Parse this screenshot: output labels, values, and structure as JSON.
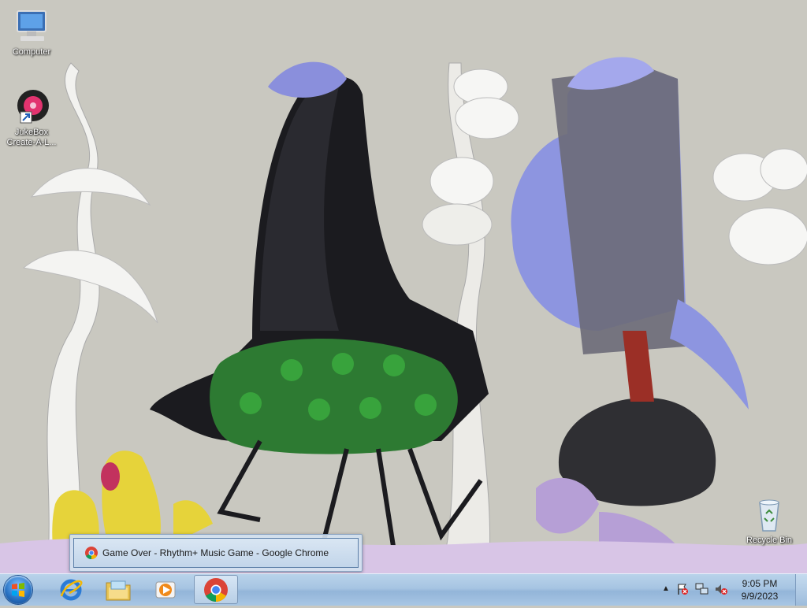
{
  "desktop": {
    "icons": [
      {
        "label": "Computer",
        "icon": "computer-icon"
      },
      {
        "label": "JukeBox Create-A-L...",
        "icon": "jukebox-shortcut-icon"
      },
      {
        "label": "Recycle Bin",
        "icon": "recycle-bin-icon"
      }
    ],
    "wallpaper": "surreal-creatures-wallpaper"
  },
  "thumbnail": {
    "title": "Game Over - Rhythm+ Music Game - Google Chrome",
    "icon": "chrome-icon"
  },
  "taskbar": {
    "start": "windows-start-orb",
    "pinned": [
      {
        "name": "internet-explorer",
        "icon": "internet-explorer-icon"
      },
      {
        "name": "windows-explorer",
        "icon": "folder-icon"
      },
      {
        "name": "media-player",
        "icon": "media-player-icon"
      },
      {
        "name": "google-chrome",
        "icon": "chrome-icon",
        "active": true
      }
    ],
    "tray": {
      "icons": [
        "show-hidden-icons-arrow",
        "action-center-flag-icon",
        "network-icon",
        "volume-muted-icon"
      ],
      "time": "9:05 PM",
      "date": "9/9/2023"
    }
  },
  "colors": {
    "wallpaper_bg": "#c9c8c0",
    "taskbar": "#a6c4e2",
    "chrome_red": "#db4437",
    "chrome_green": "#0f9d58",
    "chrome_yellow": "#f4b400",
    "chrome_blue": "#4285f4"
  }
}
